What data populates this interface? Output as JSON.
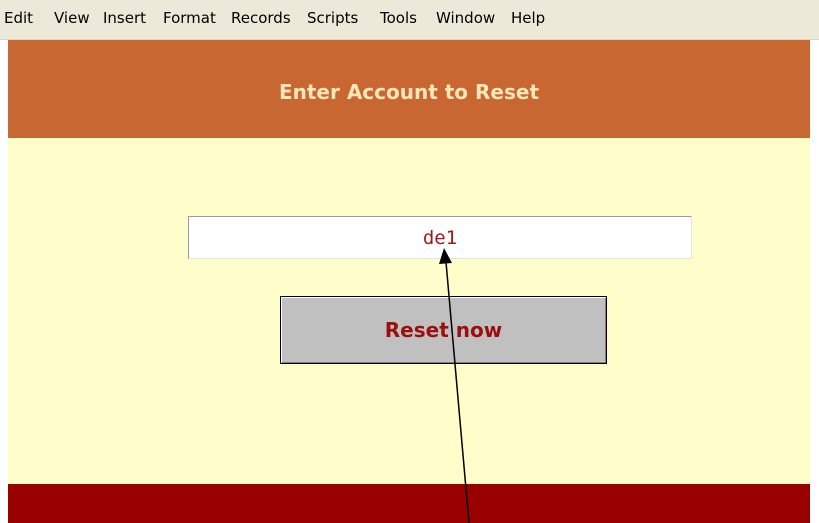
{
  "menubar": {
    "items": [
      "Edit",
      "View",
      "Insert",
      "Format",
      "Records",
      "Scripts",
      "Tools",
      "Window",
      "Help"
    ]
  },
  "header": {
    "title": "Enter Account to Reset"
  },
  "form": {
    "account_value": "de1",
    "reset_label": "Reset now"
  },
  "colors": {
    "header": "#c96733",
    "body": "#fffecb",
    "footer": "#990000",
    "accent_text": "#9b0f0f"
  }
}
